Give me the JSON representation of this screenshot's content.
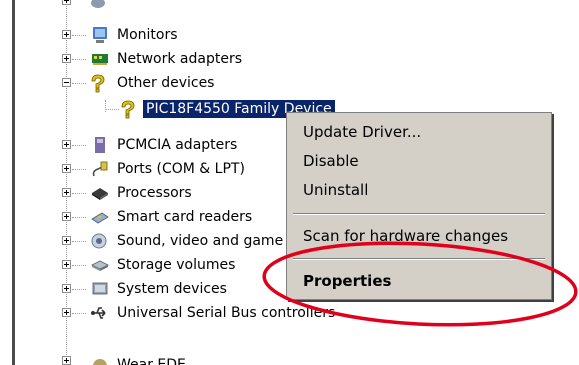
{
  "tree": {
    "items": [
      {
        "label": "Monitors",
        "icon": "monitor-icon"
      },
      {
        "label": "Network adapters",
        "icon": "network-adapter-icon"
      },
      {
        "label": "Other devices",
        "icon": "unknown-device-icon"
      },
      {
        "label": "PIC18F4550 Family Device",
        "icon": "unknown-device-icon",
        "selected": true
      },
      {
        "label": "PCMCIA adapters",
        "icon": "pcmcia-icon"
      },
      {
        "label": "Ports (COM & LPT)",
        "icon": "port-icon"
      },
      {
        "label": "Processors",
        "icon": "processor-icon"
      },
      {
        "label": "Smart card readers",
        "icon": "smart-card-icon"
      },
      {
        "label": "Sound, video and game controllers",
        "icon": "sound-icon"
      },
      {
        "label": "Storage volumes",
        "icon": "storage-icon"
      },
      {
        "label": "System devices",
        "icon": "system-device-icon"
      },
      {
        "label": "Universal Serial Bus controllers",
        "icon": "usb-icon"
      },
      {
        "label": "Wear EDE",
        "icon": "device-icon"
      }
    ]
  },
  "context_menu": {
    "update_driver": "Update Driver...",
    "disable": "Disable",
    "uninstall": "Uninstall",
    "scan": "Scan for hardware changes",
    "properties": "Properties"
  },
  "colors": {
    "selection": "#0a246a",
    "menu_bg": "#d4d0c8",
    "highlight_ellipse": "#e0001b"
  }
}
